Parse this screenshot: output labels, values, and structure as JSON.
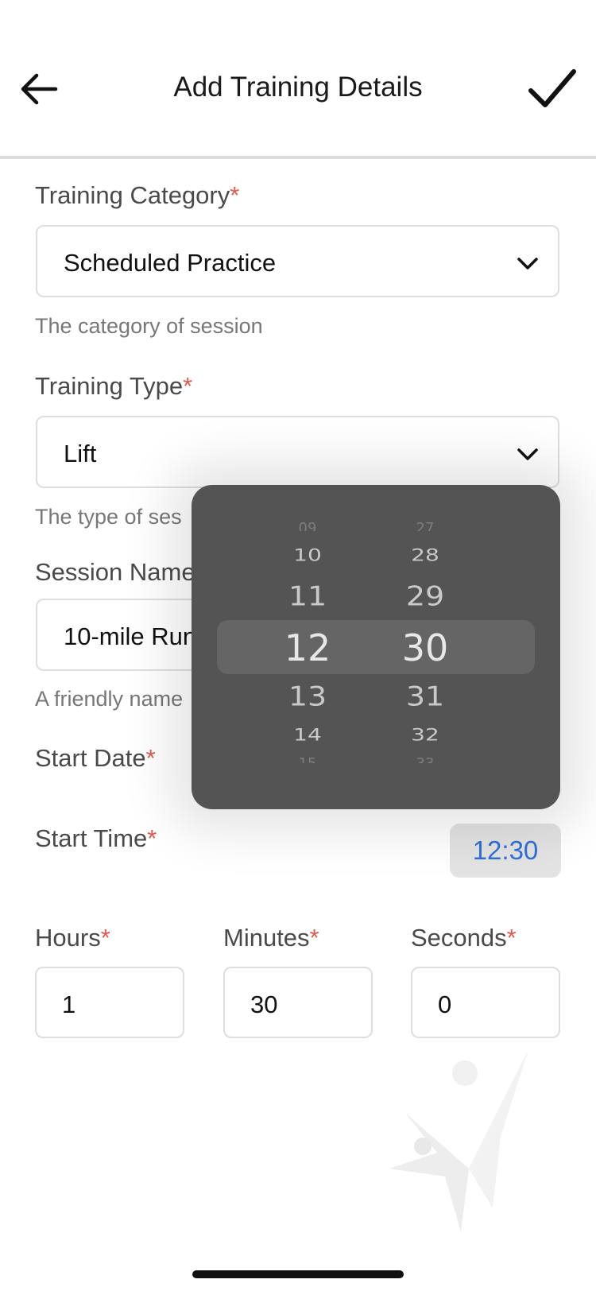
{
  "header": {
    "title": "Add Training Details",
    "back_icon": "arrow-left-icon",
    "confirm_icon": "checkmark-icon"
  },
  "form": {
    "training_category": {
      "label": "Training Category",
      "required_mark": "*",
      "value": "Scheduled Practice",
      "help": "The category of session"
    },
    "training_type": {
      "label": "Training Type",
      "required_mark": "*",
      "value": "Lift",
      "help": "The type of ses"
    },
    "session_name": {
      "label": "Session Name",
      "value": "10-mile Run",
      "help": "A friendly name"
    },
    "start_date": {
      "label": "Start Date",
      "required_mark": "*"
    },
    "start_time": {
      "label": "Start Time",
      "required_mark": "*",
      "value": "12:30"
    },
    "hours": {
      "label": "Hours",
      "required_mark": "*",
      "value": "1"
    },
    "minutes": {
      "label": "Minutes",
      "required_mark": "*",
      "value": "30"
    },
    "seconds": {
      "label": "Seconds",
      "required_mark": "*",
      "value": "0"
    }
  },
  "time_picker": {
    "hours": [
      "09",
      "10",
      "11",
      "12",
      "13",
      "14",
      "15"
    ],
    "minutes": [
      "27",
      "28",
      "29",
      "30",
      "31",
      "32",
      "33"
    ],
    "selected_hour": "12",
    "selected_minute": "30"
  },
  "colors": {
    "accent": "#2f6fd6",
    "required": "#e05a4e",
    "picker_bg": "#545454"
  }
}
